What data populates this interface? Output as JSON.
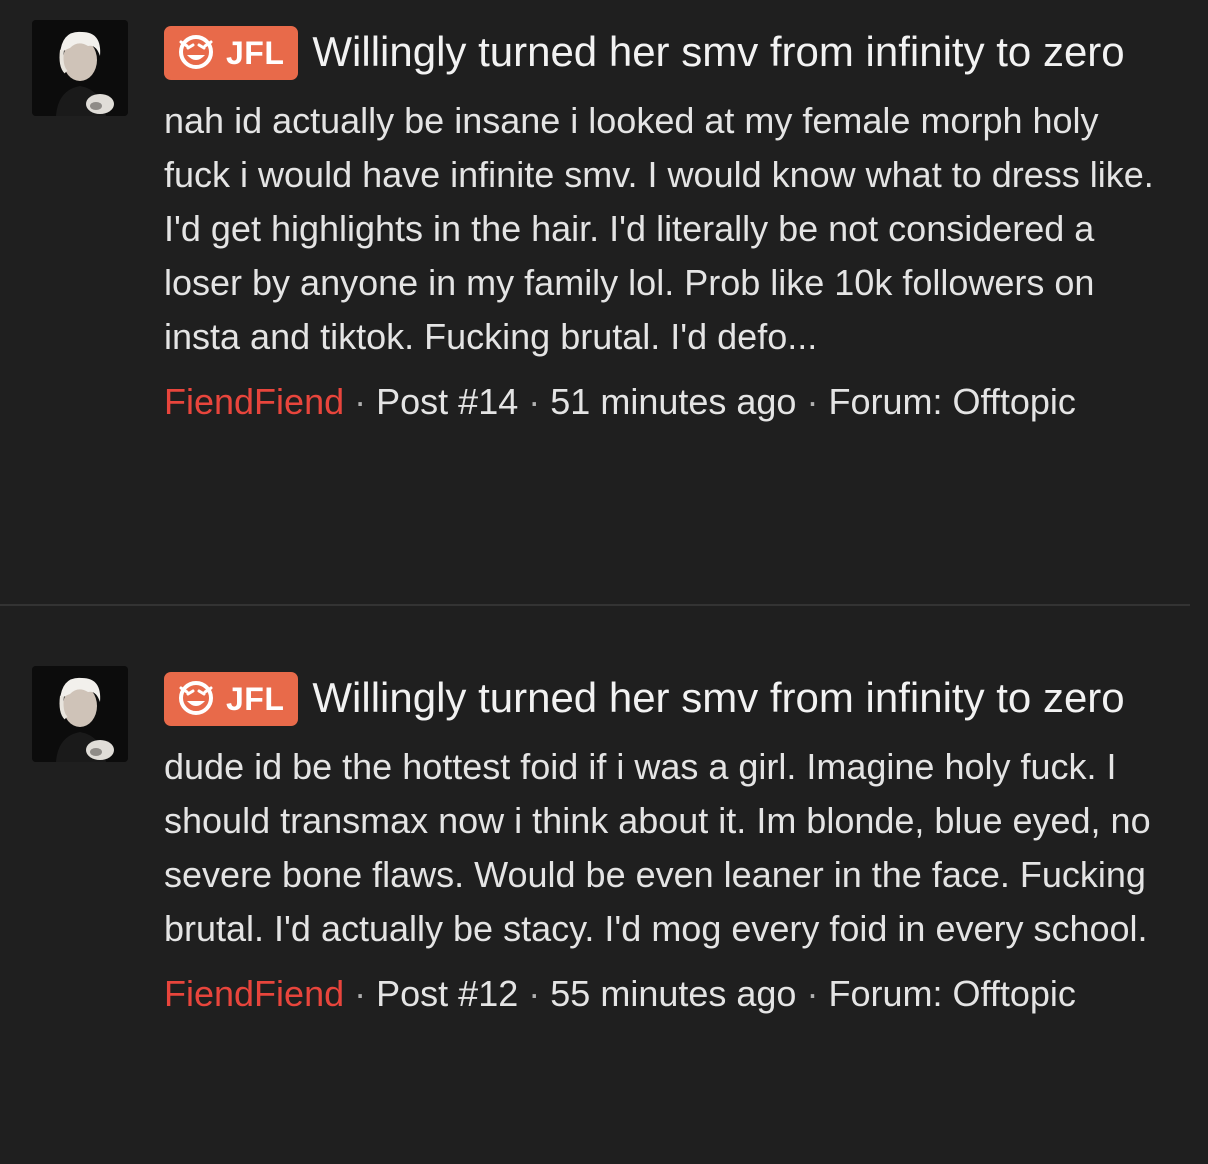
{
  "posts": [
    {
      "badge": "JFL",
      "title": "Willingly turned her smv from infinity to zero",
      "body": "nah id actually be insane i looked at my female morph holy fuck i would have infinite smv. I would know what to dress like. I'd get highlights in the hair. I'd literally be not considered a loser by anyone in my family lol. Prob like 10k followers on insta and tiktok. Fucking brutal. I'd defo...",
      "author": "FiendFiend",
      "post_number": "Post #14",
      "time": "51 minutes ago",
      "forum": "Forum: Offtopic"
    },
    {
      "badge": "JFL",
      "title": "Willingly turned her smv from infinity to zero",
      "body": "dude id be the hottest foid if i was a girl. Imagine holy fuck. I should transmax now i think about it. Im blonde, blue eyed, no severe bone flaws. Would be even leaner in the face. Fucking brutal. I'd actually be stacy. I'd mog every foid in every school.",
      "author": "FiendFiend",
      "post_number": "Post #12",
      "time": "55 minutes ago",
      "forum": "Forum: Offtopic"
    }
  ],
  "separator": "·",
  "colors": {
    "background": "#1f1f1f",
    "badge": "#e86a4a",
    "author": "#e8453c",
    "text": "#e4e4e4"
  }
}
